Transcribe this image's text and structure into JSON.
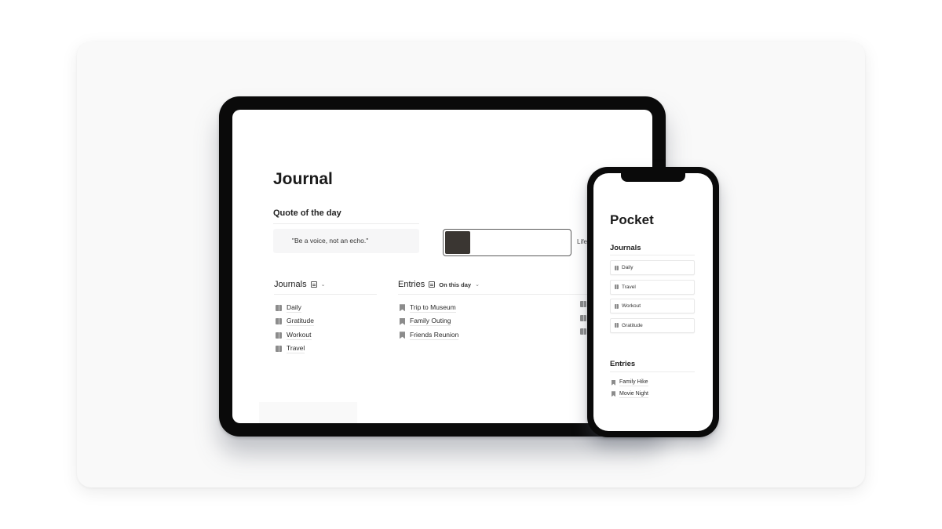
{
  "tablet": {
    "page_title": "Journal",
    "quote": {
      "heading": "Quote of the day",
      "text": "\"Be a voice, not an echo.\""
    },
    "progress": {
      "label": "Life",
      "fraction": 0.2
    },
    "journals": {
      "label": "Journals",
      "view_icon": "list-view-icon",
      "items": [
        {
          "label": "Daily",
          "icon": "book-icon"
        },
        {
          "label": "Gratitude",
          "icon": "book-icon"
        },
        {
          "label": "Workout",
          "icon": "book-icon"
        },
        {
          "label": "Travel",
          "icon": "book-icon"
        }
      ]
    },
    "entries": {
      "label": "Entries",
      "view_icon": "list-view-icon",
      "view_label": "On this day",
      "items": [
        {
          "label": "Trip to Museum",
          "icon": "bookmark-icon"
        },
        {
          "label": "Family Outing",
          "icon": "bookmark-icon"
        },
        {
          "label": "Friends Reunion",
          "icon": "bookmark-icon"
        }
      ]
    }
  },
  "phone": {
    "page_title": "Pocket",
    "journals": {
      "label": "Journals",
      "items": [
        {
          "label": "Daily",
          "icon": "book-icon"
        },
        {
          "label": "Travel",
          "icon": "book-icon"
        },
        {
          "label": "Workout",
          "icon": "book-icon"
        },
        {
          "label": "Gratitude",
          "icon": "book-icon"
        }
      ]
    },
    "entries": {
      "label": "Entries",
      "items": [
        {
          "label": "Family Hike",
          "icon": "bookmark-icon"
        },
        {
          "label": "Movie Night",
          "icon": "bookmark-icon"
        }
      ]
    }
  },
  "colors": {
    "card_bg": "#f9f9f9",
    "device_frame": "#0a0a0a",
    "progress_fill": "#3a3632",
    "icon_gray": "#8c8c8c"
  }
}
